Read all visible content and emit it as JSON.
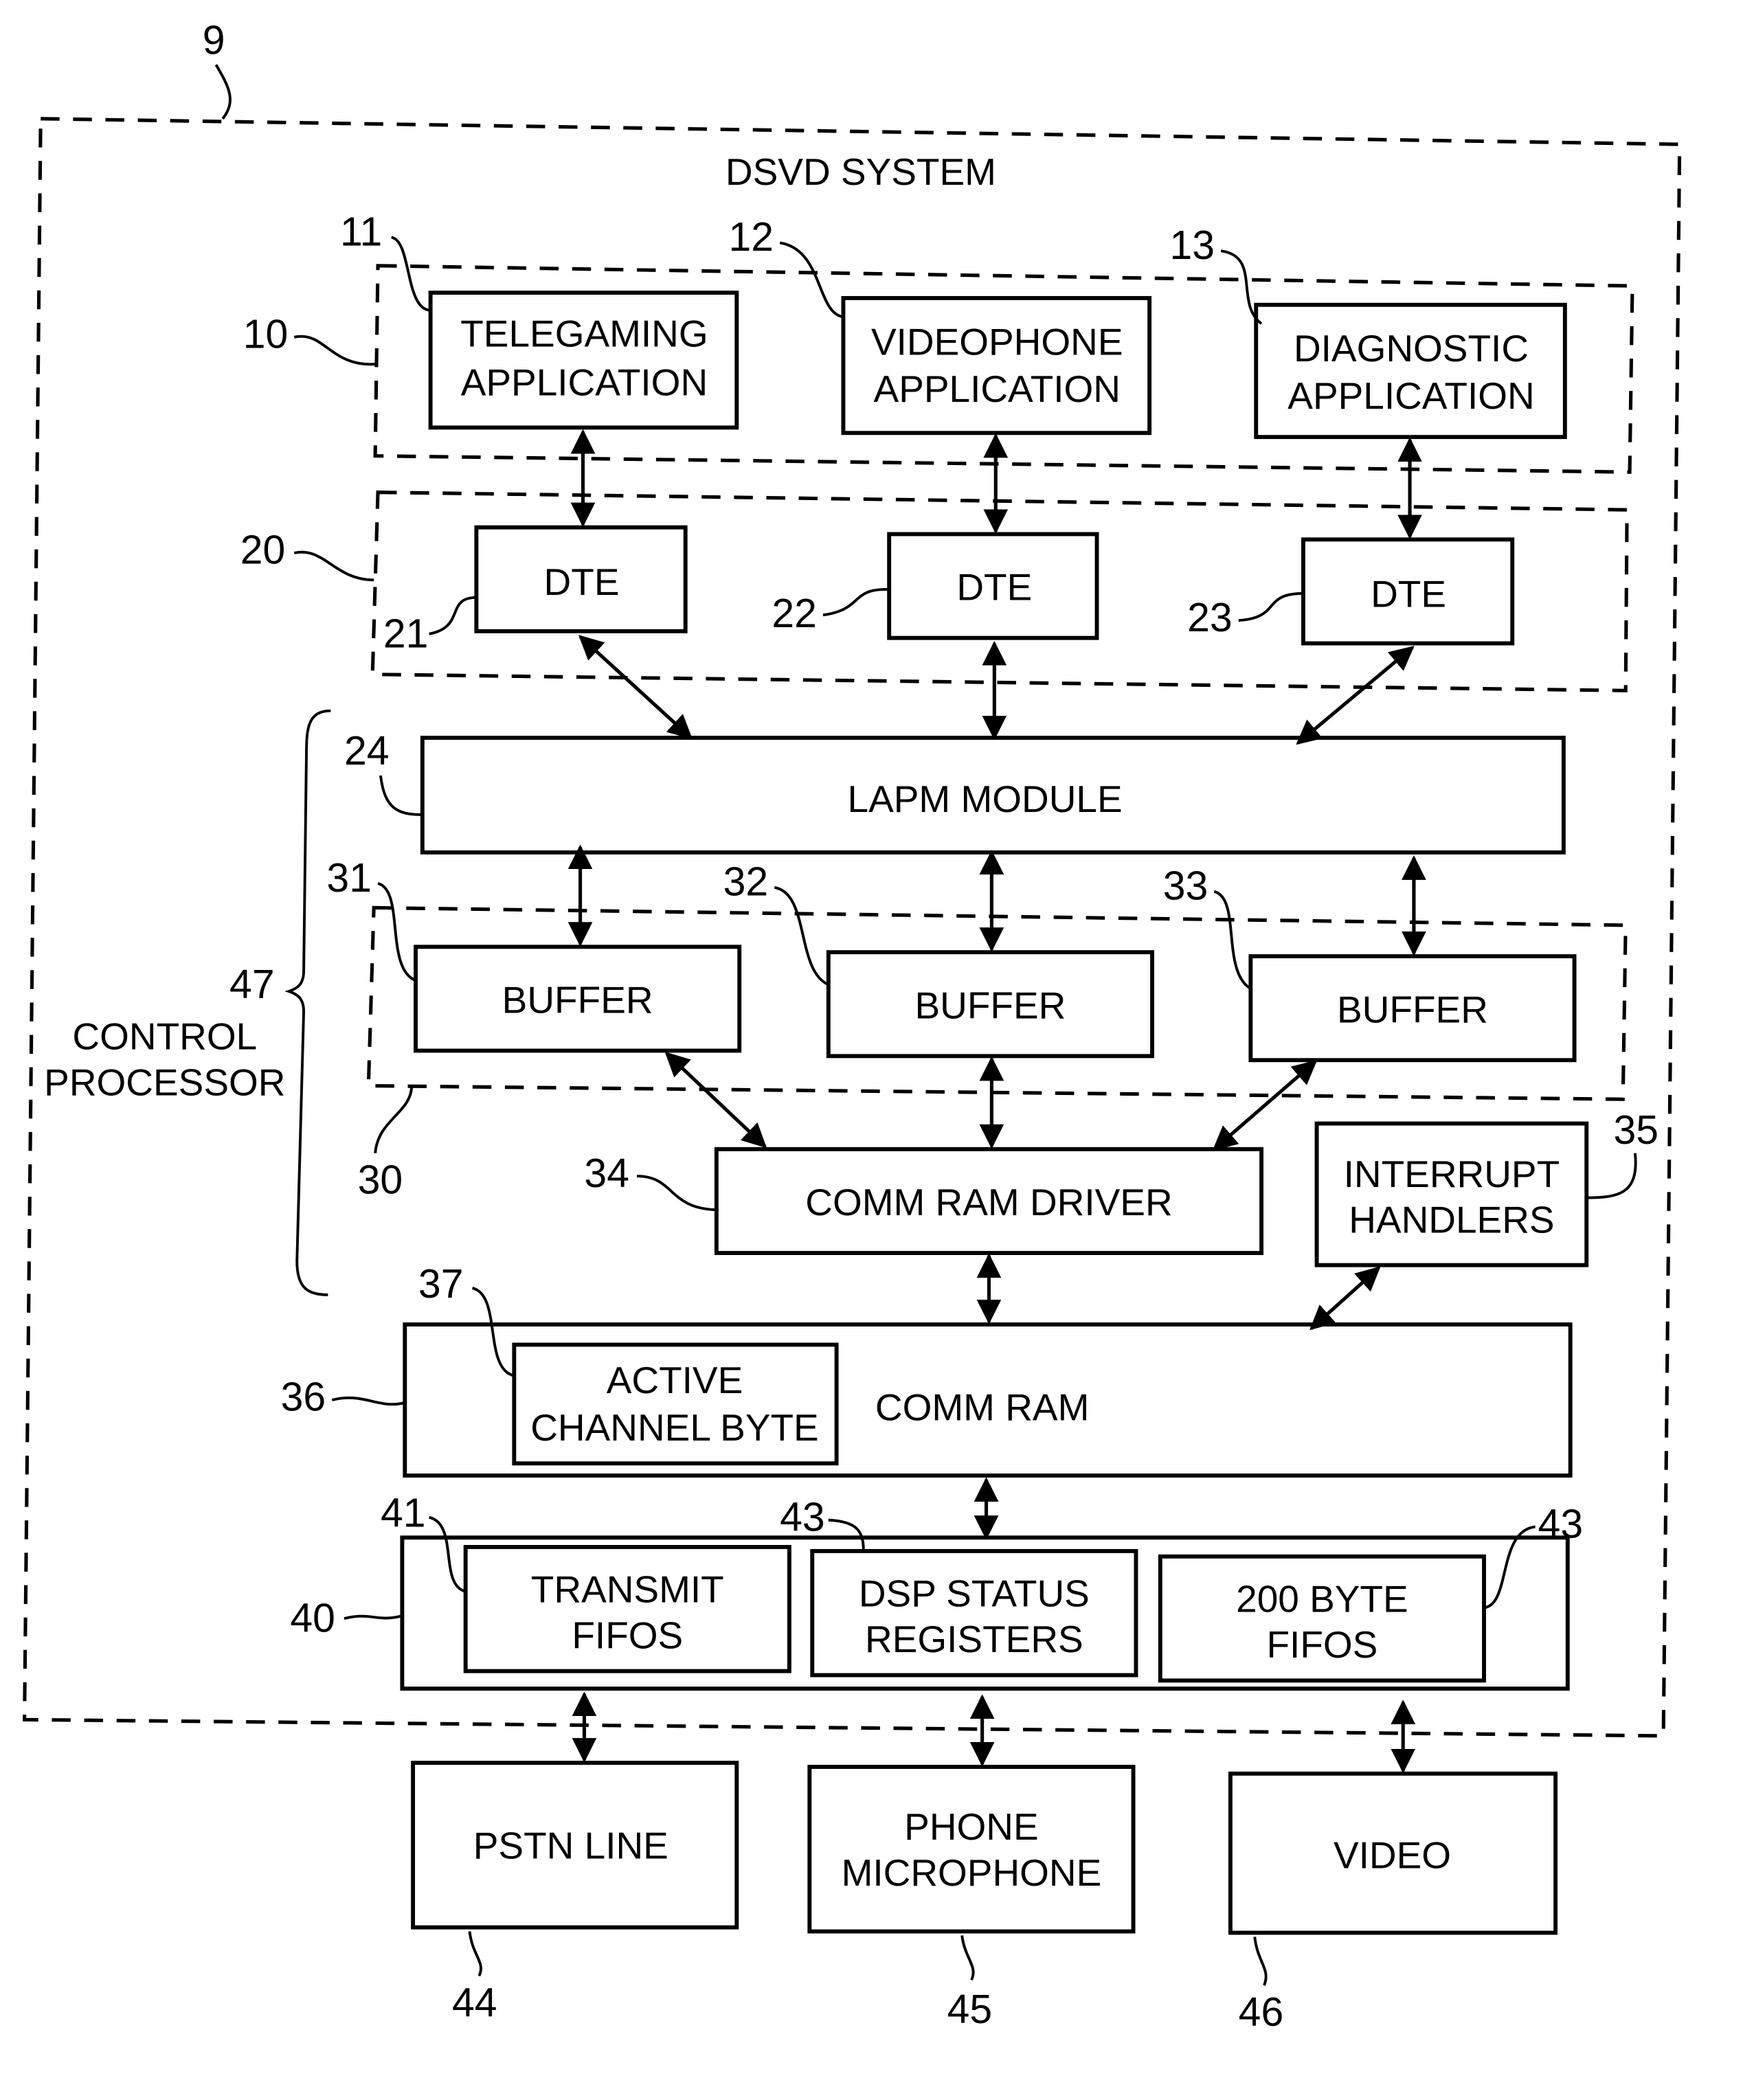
{
  "diagram": {
    "title": "DSVD SYSTEM",
    "ref_system": "9",
    "applications_group": {
      "ref": "10",
      "items": [
        {
          "ref": "11",
          "lines": [
            "TELEGAMING",
            "APPLICATION"
          ]
        },
        {
          "ref": "12",
          "lines": [
            "VIDEOPHONE",
            "APPLICATION"
          ]
        },
        {
          "ref": "13",
          "lines": [
            "DIAGNOSTIC",
            "APPLICATION"
          ]
        }
      ]
    },
    "dte_group": {
      "ref": "20",
      "items": [
        {
          "ref": "21",
          "label": "DTE"
        },
        {
          "ref": "22",
          "label": "DTE"
        },
        {
          "ref": "23",
          "label": "DTE"
        }
      ]
    },
    "lapm": {
      "ref": "24",
      "label": "LAPM MODULE"
    },
    "buffer_group": {
      "ref": "30",
      "items": [
        {
          "ref": "31",
          "label": "BUFFER"
        },
        {
          "ref": "32",
          "label": "BUFFER"
        },
        {
          "ref": "33",
          "label": "BUFFER"
        }
      ]
    },
    "comm_ram_driver": {
      "ref": "34",
      "label": "COMM RAM DRIVER"
    },
    "interrupt_handlers": {
      "ref": "35",
      "lines": [
        "INTERRUPT",
        "HANDLERS"
      ]
    },
    "control_processor": {
      "ref": "47",
      "lines": [
        "CONTROL",
        "PROCESSOR"
      ]
    },
    "comm_ram": {
      "ref": "36",
      "label": "COMM RAM",
      "active_channel": {
        "ref": "37",
        "lines": [
          "ACTIVE",
          "CHANNEL BYTE"
        ]
      }
    },
    "dsp_group": {
      "ref": "40",
      "items": [
        {
          "ref": "41",
          "lines": [
            "TRANSMIT",
            "FIFOS"
          ]
        },
        {
          "ref": "43",
          "lines": [
            "DSP STATUS",
            "REGISTERS"
          ]
        },
        {
          "ref": "43",
          "lines": [
            "200 BYTE",
            "FIFOS"
          ]
        }
      ]
    },
    "externals": [
      {
        "ref": "44",
        "lines": [
          "PSTN LINE"
        ]
      },
      {
        "ref": "45",
        "lines": [
          "PHONE",
          "MICROPHONE"
        ]
      },
      {
        "ref": "46",
        "lines": [
          "VIDEO"
        ]
      }
    ]
  }
}
